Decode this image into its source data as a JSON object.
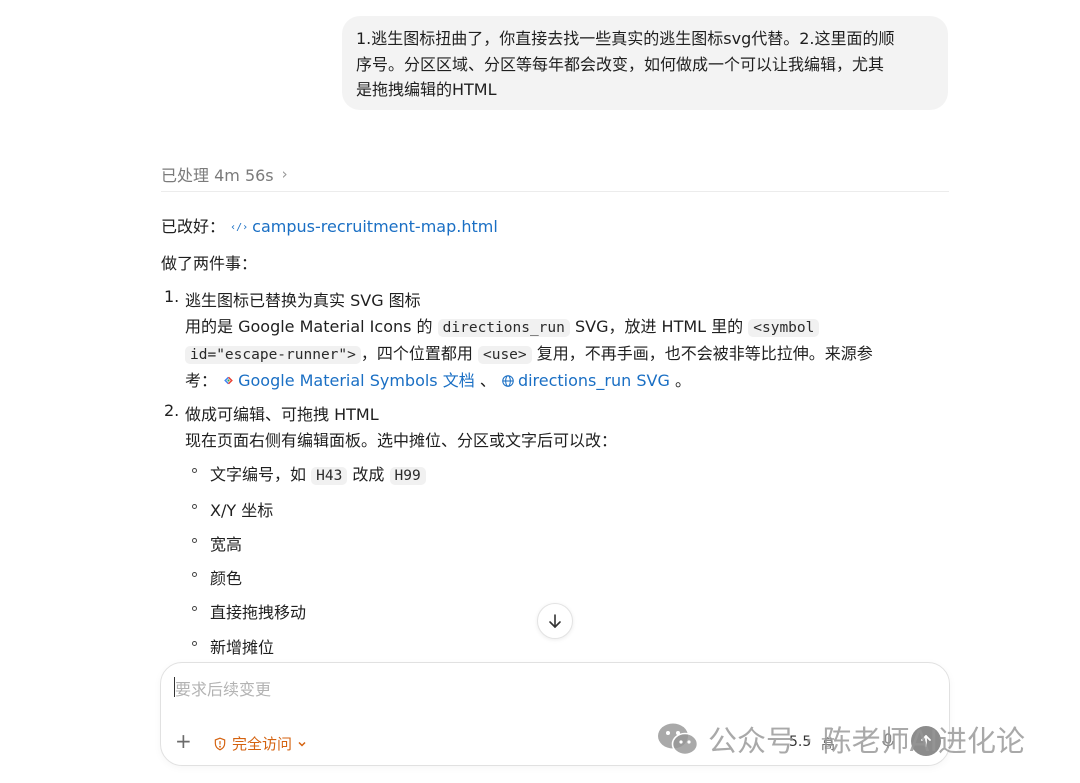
{
  "user_message": {
    "lines": [
      "1.逃生图标扭曲了，你直接去找一些真实的逃生图标svg代替。2.这里面的顺",
      "序号。分区区域、分区等每年都会改变，如何做成一个可以让我编辑，尤其",
      "是拖拽编辑的HTML"
    ]
  },
  "processed": {
    "label": "已处理 4m 56s"
  },
  "response": {
    "changed_prefix": "已改好：",
    "file_link": "campus-recruitment-map.html",
    "did_two_things": "做了两件事：",
    "item1": {
      "num": "1.",
      "title": "逃生图标已替换为真实 SVG 图标",
      "l1_a": "用的是 Google Material Icons 的",
      "l1_code": "directions_run",
      "l1_b": "SVG，放进 HTML 里的",
      "l1_code2": "<symbol",
      "l2_code": "id=\"escape-runner\">",
      "l2_a": "，四个位置都用",
      "l2_code2": "<use>",
      "l2_b": "复用，不再手画，也不会被非等比拉伸。来源参",
      "l3_a": "考：",
      "l3_link1": "Google Material Symbols 文档",
      "l3_sep": "、",
      "l3_link2": "directions_run SVG",
      "l3_end": "。"
    },
    "item2": {
      "num": "2.",
      "title": "做成可编辑、可拖拽 HTML",
      "desc": "现在页面右侧有编辑面板。选中摊位、分区或文字后可以改：",
      "bullets": {
        "b1_a": "文字编号，如",
        "b1_code1": "H43",
        "b1_b": "改成",
        "b1_code2": "H99",
        "b2": "X/Y 坐标",
        "b3": "宽高",
        "b4": "颜色",
        "b5": "直接拖拽移动",
        "b6": "新增摊位"
      }
    }
  },
  "composer": {
    "placeholder": "要求后续变更",
    "access_label": "完全访问",
    "model_label": "5.5",
    "effort_label": "高"
  },
  "watermark": {
    "text": "公众号 · 陈老师AI进化论"
  },
  "icons": {
    "chevron": "chevron-right-icon",
    "code_file": "code-file-icon",
    "google": "google-icon",
    "globe": "globe-icon",
    "arrow_down": "arrow-down-icon",
    "plus": "plus-icon",
    "shield": "shield-warning-icon",
    "mic": "mic-icon",
    "send": "arrow-up-icon",
    "wechat": "wechat-icon"
  },
  "colors": {
    "link": "#1a6fc4",
    "access": "#d4620f",
    "bubble_bg": "#f3f3f3",
    "send_bg": "#8c8c8c"
  }
}
